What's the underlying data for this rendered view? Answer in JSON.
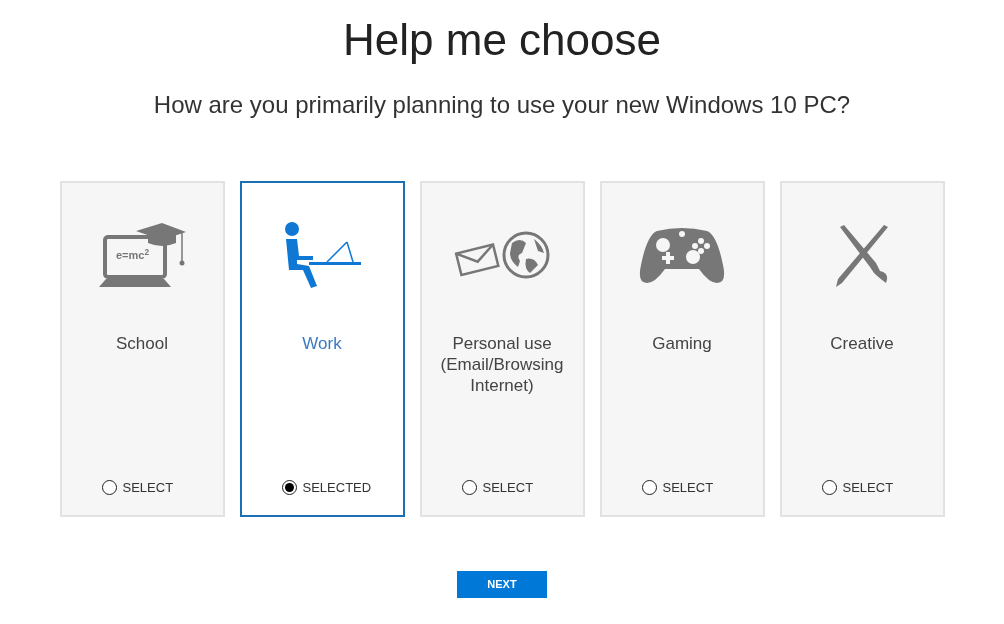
{
  "title": "Help me choose",
  "subtitle": "How are you primarily planning to use your new Windows 10 PC?",
  "cards": [
    {
      "kind": "school",
      "label": "School",
      "icon_text": "e=mc$^{2}$",
      "radio_label": "SELECT",
      "selected": false
    },
    {
      "kind": "work",
      "label": "Work",
      "radio_label": "SELECTED",
      "selected": true
    },
    {
      "kind": "personal",
      "label": "Personal use (Email/Browsing Internet)",
      "radio_label": "SELECT",
      "selected": false
    },
    {
      "kind": "gaming",
      "label": "Gaming",
      "radio_label": "SELECT",
      "selected": false
    },
    {
      "kind": "creative",
      "label": "Creative",
      "radio_label": "SELECT",
      "selected": false
    }
  ],
  "next_button": "NEXT"
}
